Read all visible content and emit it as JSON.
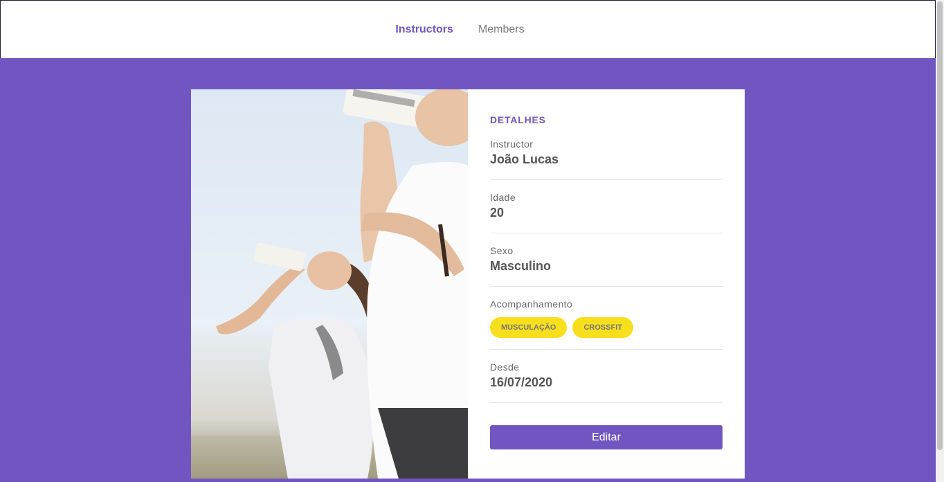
{
  "nav": {
    "items": [
      {
        "label": "Instructors",
        "active": true
      },
      {
        "label": "Members",
        "active": false
      }
    ]
  },
  "details": {
    "heading": "DETALHES",
    "fields": [
      {
        "label": "Instructor",
        "value": "João Lucas"
      },
      {
        "label": "Idade",
        "value": "20"
      },
      {
        "label": "Sexo",
        "value": "Masculino"
      },
      {
        "label": "Acompanhamento",
        "tags": [
          "MUSCULAÇÃO",
          "CROSSFIT"
        ]
      },
      {
        "label": "Desde",
        "value": "16/07/2020"
      }
    ],
    "edit_button": "Editar"
  },
  "colors": {
    "primary": "#7156c1",
    "tag": "#f7df1e",
    "background": "#7156c1"
  },
  "photo": {
    "icon": "instructor-photo"
  }
}
